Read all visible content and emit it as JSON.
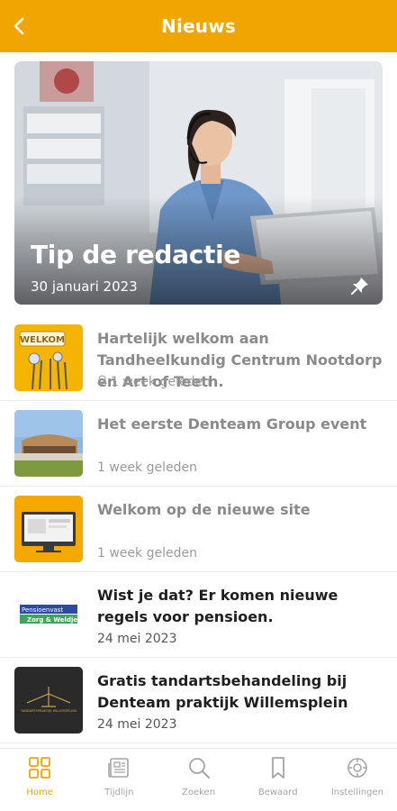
{
  "header": {
    "title": "Nieuws",
    "back_icon": "chevron-left-icon"
  },
  "featured": {
    "title": "Tip de redactie",
    "date": "30 januari 2023",
    "pin_icon": "pin-icon"
  },
  "news": [
    {
      "title": "Hartelijk welkom aan Tandheelkundig Centrum Nootdorp en Art of Teeth.",
      "meta": "1 week geleden",
      "bell_icon": "bell-icon",
      "thumb_text": "WELKOM",
      "read": true
    },
    {
      "title": "Het eerste Denteam Group event",
      "meta": "1 week geleden",
      "read": true
    },
    {
      "title": "Welkom op de nieuwe site",
      "meta": "1 week geleden",
      "read": true
    },
    {
      "title": "Wist je dat? Er komen nieuwe regels voor pensioen.",
      "meta": "24 mei 2023",
      "thumb_line1": "Pensioenvast",
      "thumb_line2": "Zorg & Weldje",
      "read": false
    },
    {
      "title": "Gratis tandartsbehandeling bij Denteam praktijk Willemsplein",
      "meta": "24 mei 2023",
      "thumb_text": "TANDARTSPRAKTIJK WILLEMSPLEIN",
      "read": false
    }
  ],
  "tabs": [
    {
      "label": "Home",
      "icon": "grid-icon",
      "active": true
    },
    {
      "label": "Tijdlijn",
      "icon": "newspaper-icon",
      "active": false
    },
    {
      "label": "Zoeken",
      "icon": "search-icon",
      "active": false
    },
    {
      "label": "Bewaard",
      "icon": "bookmark-icon",
      "active": false
    },
    {
      "label": "Instellingen",
      "icon": "settings-icon",
      "active": false
    }
  ],
  "colors": {
    "accent": "#f0a500",
    "read_text": "#8a8a8a",
    "unread_text": "#1f1f1f",
    "tab_inactive": "#a5a5a5"
  }
}
